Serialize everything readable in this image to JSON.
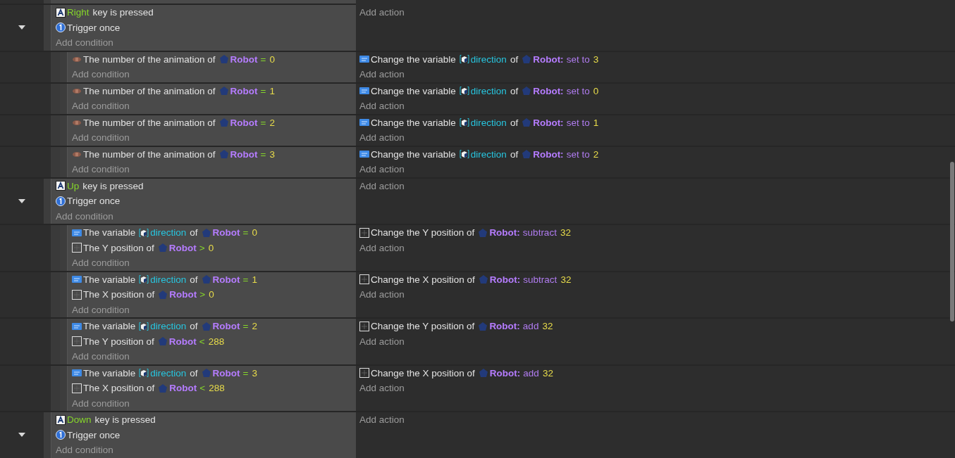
{
  "events": [
    {
      "expanded": true,
      "conditions": [
        {
          "kind": "key",
          "parts": [
            {
              "kind": "key",
              "text": "Right"
            },
            {
              "kind": "plain",
              "text": "key is pressed"
            }
          ]
        },
        {
          "kind": "trigger",
          "parts": [
            {
              "kind": "plain",
              "text": "Trigger once"
            }
          ]
        }
      ],
      "add_condition": "Add condition",
      "add_action": "Add action",
      "children": [
        {
          "conditions": [
            {
              "kind": "animation",
              "parts": [
                {
                  "kind": "plain",
                  "text": "The number of the animation of"
                },
                {
                  "kind": "object",
                  "text": "Robot"
                },
                {
                  "kind": "operator",
                  "text": "="
                },
                {
                  "kind": "value",
                  "text": "0"
                }
              ]
            }
          ],
          "add_condition": "Add condition",
          "actions": [
            {
              "kind": "variable",
              "parts": [
                {
                  "kind": "plain",
                  "text": "Change the variable"
                },
                {
                  "kind": "variable",
                  "text": "direction"
                },
                {
                  "kind": "plain",
                  "text": "of"
                },
                {
                  "kind": "object",
                  "text": "Robot:"
                },
                {
                  "kind": "operation",
                  "text": "set to"
                },
                {
                  "kind": "value",
                  "text": "3"
                }
              ]
            }
          ],
          "add_action": "Add action"
        },
        {
          "conditions": [
            {
              "kind": "animation",
              "parts": [
                {
                  "kind": "plain",
                  "text": "The number of the animation of"
                },
                {
                  "kind": "object",
                  "text": "Robot"
                },
                {
                  "kind": "operator",
                  "text": "="
                },
                {
                  "kind": "value",
                  "text": "1"
                }
              ]
            }
          ],
          "add_condition": "Add condition",
          "actions": [
            {
              "kind": "variable",
              "parts": [
                {
                  "kind": "plain",
                  "text": "Change the variable"
                },
                {
                  "kind": "variable",
                  "text": "direction"
                },
                {
                  "kind": "plain",
                  "text": "of"
                },
                {
                  "kind": "object",
                  "text": "Robot:"
                },
                {
                  "kind": "operation",
                  "text": "set to"
                },
                {
                  "kind": "value",
                  "text": "0"
                }
              ]
            }
          ],
          "add_action": "Add action"
        },
        {
          "conditions": [
            {
              "kind": "animation",
              "parts": [
                {
                  "kind": "plain",
                  "text": "The number of the animation of"
                },
                {
                  "kind": "object",
                  "text": "Robot"
                },
                {
                  "kind": "operator",
                  "text": "="
                },
                {
                  "kind": "value",
                  "text": "2"
                }
              ]
            }
          ],
          "add_condition": "Add condition",
          "actions": [
            {
              "kind": "variable",
              "parts": [
                {
                  "kind": "plain",
                  "text": "Change the variable"
                },
                {
                  "kind": "variable",
                  "text": "direction"
                },
                {
                  "kind": "plain",
                  "text": "of"
                },
                {
                  "kind": "object",
                  "text": "Robot:"
                },
                {
                  "kind": "operation",
                  "text": "set to"
                },
                {
                  "kind": "value",
                  "text": "1"
                }
              ]
            }
          ],
          "add_action": "Add action"
        },
        {
          "conditions": [
            {
              "kind": "animation",
              "parts": [
                {
                  "kind": "plain",
                  "text": "The number of the animation of"
                },
                {
                  "kind": "object",
                  "text": "Robot"
                },
                {
                  "kind": "operator",
                  "text": "="
                },
                {
                  "kind": "value",
                  "text": "3"
                }
              ]
            }
          ],
          "add_condition": "Add condition",
          "actions": [
            {
              "kind": "variable",
              "parts": [
                {
                  "kind": "plain",
                  "text": "Change the variable"
                },
                {
                  "kind": "variable",
                  "text": "direction"
                },
                {
                  "kind": "plain",
                  "text": "of"
                },
                {
                  "kind": "object",
                  "text": "Robot:"
                },
                {
                  "kind": "operation",
                  "text": "set to"
                },
                {
                  "kind": "value",
                  "text": "2"
                }
              ]
            }
          ],
          "add_action": "Add action"
        }
      ]
    },
    {
      "expanded": true,
      "conditions": [
        {
          "kind": "key",
          "parts": [
            {
              "kind": "key",
              "text": "Up"
            },
            {
              "kind": "plain",
              "text": "key is pressed"
            }
          ]
        },
        {
          "kind": "trigger",
          "parts": [
            {
              "kind": "plain",
              "text": "Trigger once"
            }
          ]
        }
      ],
      "add_condition": "Add condition",
      "add_action": "Add action",
      "children": [
        {
          "conditions": [
            {
              "kind": "variable",
              "parts": [
                {
                  "kind": "plain",
                  "text": "The variable"
                },
                {
                  "kind": "variable",
                  "text": "direction"
                },
                {
                  "kind": "plain",
                  "text": "of"
                },
                {
                  "kind": "object",
                  "text": "Robot"
                },
                {
                  "kind": "operator",
                  "text": "="
                },
                {
                  "kind": "value",
                  "text": "0"
                }
              ]
            },
            {
              "kind": "position",
              "parts": [
                {
                  "kind": "plain",
                  "text": "The Y position of"
                },
                {
                  "kind": "object",
                  "text": "Robot"
                },
                {
                  "kind": "operator",
                  "text": ">"
                },
                {
                  "kind": "value",
                  "text": "0"
                }
              ]
            }
          ],
          "add_condition": "Add condition",
          "actions": [
            {
              "kind": "position",
              "parts": [
                {
                  "kind": "plain",
                  "text": "Change the Y position of"
                },
                {
                  "kind": "object",
                  "text": "Robot:"
                },
                {
                  "kind": "operation",
                  "text": "subtract"
                },
                {
                  "kind": "value",
                  "text": "32"
                }
              ]
            }
          ],
          "add_action": "Add action"
        },
        {
          "conditions": [
            {
              "kind": "variable",
              "parts": [
                {
                  "kind": "plain",
                  "text": "The variable"
                },
                {
                  "kind": "variable",
                  "text": "direction"
                },
                {
                  "kind": "plain",
                  "text": "of"
                },
                {
                  "kind": "object",
                  "text": "Robot"
                },
                {
                  "kind": "operator",
                  "text": "="
                },
                {
                  "kind": "value",
                  "text": "1"
                }
              ]
            },
            {
              "kind": "position",
              "parts": [
                {
                  "kind": "plain",
                  "text": "The X position of"
                },
                {
                  "kind": "object",
                  "text": "Robot"
                },
                {
                  "kind": "operator",
                  "text": ">"
                },
                {
                  "kind": "value",
                  "text": "0"
                }
              ]
            }
          ],
          "add_condition": "Add condition",
          "actions": [
            {
              "kind": "position",
              "parts": [
                {
                  "kind": "plain",
                  "text": "Change the X position of"
                },
                {
                  "kind": "object",
                  "text": "Robot:"
                },
                {
                  "kind": "operation",
                  "text": "subtract"
                },
                {
                  "kind": "value",
                  "text": "32"
                }
              ]
            }
          ],
          "add_action": "Add action"
        },
        {
          "conditions": [
            {
              "kind": "variable",
              "parts": [
                {
                  "kind": "plain",
                  "text": "The variable"
                },
                {
                  "kind": "variable",
                  "text": "direction"
                },
                {
                  "kind": "plain",
                  "text": "of"
                },
                {
                  "kind": "object",
                  "text": "Robot"
                },
                {
                  "kind": "operator",
                  "text": "="
                },
                {
                  "kind": "value",
                  "text": "2"
                }
              ]
            },
            {
              "kind": "position",
              "parts": [
                {
                  "kind": "plain",
                  "text": "The Y position of"
                },
                {
                  "kind": "object",
                  "text": "Robot"
                },
                {
                  "kind": "operator",
                  "text": "<"
                },
                {
                  "kind": "value",
                  "text": "288"
                }
              ]
            }
          ],
          "add_condition": "Add condition",
          "actions": [
            {
              "kind": "position",
              "parts": [
                {
                  "kind": "plain",
                  "text": "Change the Y position of"
                },
                {
                  "kind": "object",
                  "text": "Robot:"
                },
                {
                  "kind": "operation",
                  "text": "add"
                },
                {
                  "kind": "value",
                  "text": "32"
                }
              ]
            }
          ],
          "add_action": "Add action"
        },
        {
          "conditions": [
            {
              "kind": "variable",
              "parts": [
                {
                  "kind": "plain",
                  "text": "The variable"
                },
                {
                  "kind": "variable",
                  "text": "direction"
                },
                {
                  "kind": "plain",
                  "text": "of"
                },
                {
                  "kind": "object",
                  "text": "Robot"
                },
                {
                  "kind": "operator",
                  "text": "="
                },
                {
                  "kind": "value",
                  "text": "3"
                }
              ]
            },
            {
              "kind": "position",
              "parts": [
                {
                  "kind": "plain",
                  "text": "The X position of"
                },
                {
                  "kind": "object",
                  "text": "Robot"
                },
                {
                  "kind": "operator",
                  "text": "<"
                },
                {
                  "kind": "value",
                  "text": "288"
                }
              ]
            }
          ],
          "add_condition": "Add condition",
          "actions": [
            {
              "kind": "position",
              "parts": [
                {
                  "kind": "plain",
                  "text": "Change the X position of"
                },
                {
                  "kind": "object",
                  "text": "Robot:"
                },
                {
                  "kind": "operation",
                  "text": "add"
                },
                {
                  "kind": "value",
                  "text": "32"
                }
              ]
            }
          ],
          "add_action": "Add action"
        }
      ]
    },
    {
      "expanded": true,
      "conditions": [
        {
          "kind": "key",
          "parts": [
            {
              "kind": "key",
              "text": "Down"
            },
            {
              "kind": "plain",
              "text": "key is pressed"
            }
          ]
        },
        {
          "kind": "trigger",
          "parts": [
            {
              "kind": "plain",
              "text": "Trigger once"
            }
          ]
        }
      ],
      "add_condition": "Add condition",
      "add_action": "Add action"
    }
  ]
}
